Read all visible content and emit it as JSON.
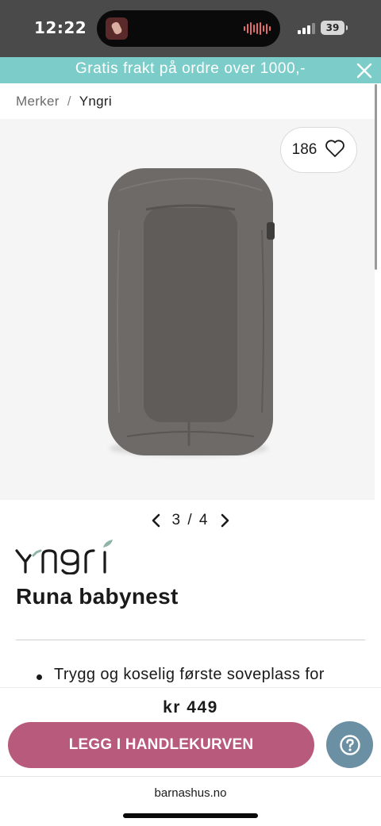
{
  "status_bar": {
    "time": "12:22",
    "battery": "39"
  },
  "promo": {
    "text": "Gratis frakt på ordre over 1000,-",
    "close_icon": "close-icon"
  },
  "breadcrumb": {
    "parent": "Merker",
    "separator": "/",
    "current": "Yngri"
  },
  "product": {
    "likes": "186",
    "gallery": {
      "current": 3,
      "total": 4,
      "text": "3 / 4"
    },
    "brand": "Yngri",
    "title": "Runa babynest",
    "description_items": [
      "Trygg og koselig første soveplass for"
    ],
    "price": "kr 449",
    "image_color": "#6e6a67"
  },
  "actions": {
    "cart_label": "LEGG I HANDLEKURVEN",
    "help_icon": "help-question-icon"
  },
  "browser": {
    "url": "barnashus.no"
  },
  "colors": {
    "promo": "#7ccdc9",
    "cart_button": "#b85a7c",
    "help_button": "#6b8fa3",
    "brand_leaf": "#8fb4a8"
  }
}
